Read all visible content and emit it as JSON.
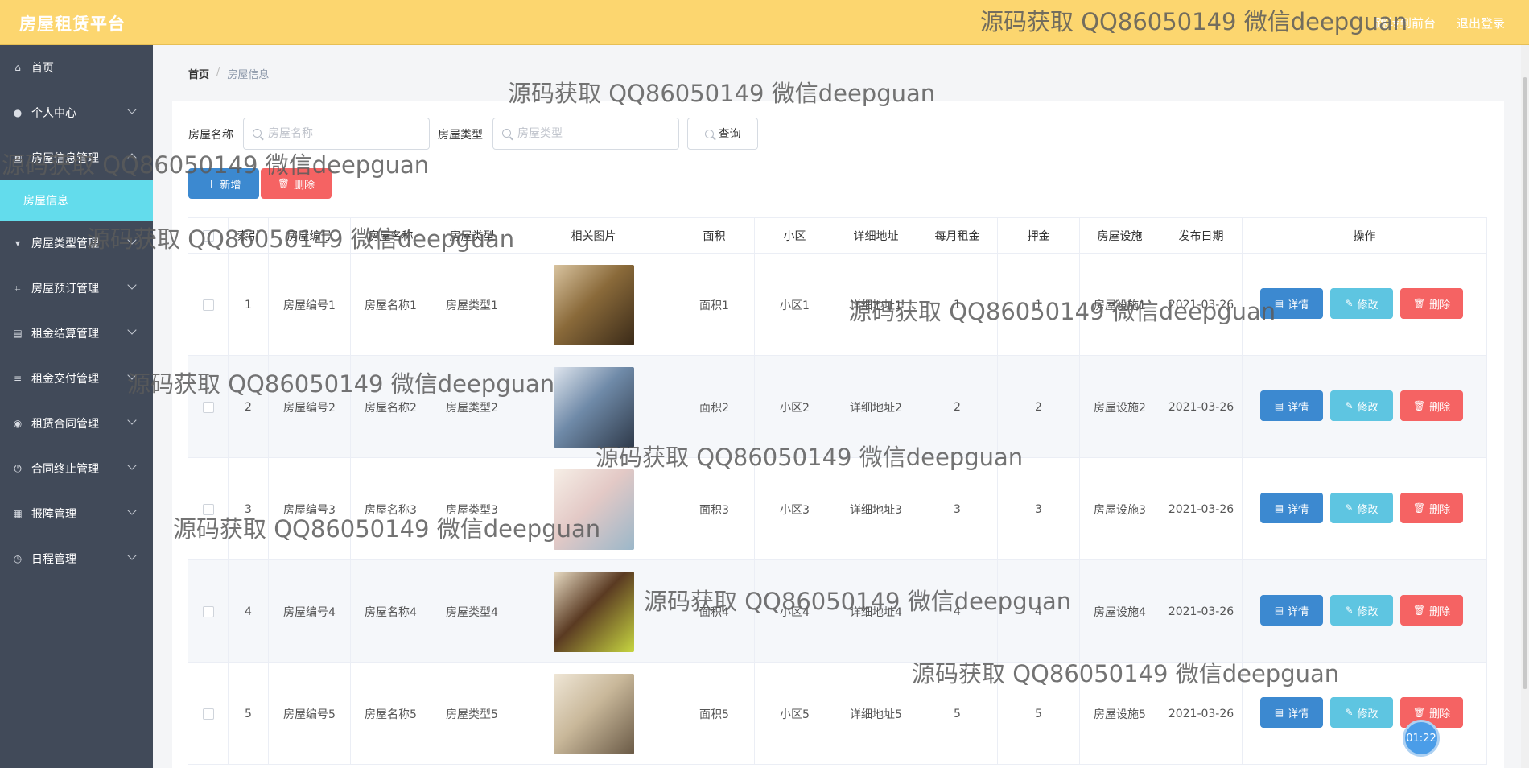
{
  "header": {
    "title": "房屋租赁平台",
    "links": [
      "跳转到前台",
      "退出登录"
    ]
  },
  "sidebar": {
    "items": [
      {
        "label": "首页",
        "icon": "home-icon"
      },
      {
        "label": "个人中心",
        "icon": "user-icon"
      },
      {
        "label": "房屋信息管理",
        "icon": "house-icon"
      },
      {
        "label": "房屋类型管理",
        "icon": "tag-icon"
      },
      {
        "label": "房屋预订管理",
        "icon": "crop-icon"
      },
      {
        "label": "租金结算管理",
        "icon": "clipboard-icon"
      },
      {
        "label": "租金交付管理",
        "icon": "list-icon"
      },
      {
        "label": "租赁合同管理",
        "icon": "location-icon"
      },
      {
        "label": "合同终止管理",
        "icon": "power-icon"
      },
      {
        "label": "报障管理",
        "icon": "grid-icon"
      },
      {
        "label": "日程管理",
        "icon": "clock-icon"
      }
    ],
    "active_sub": "房屋信息"
  },
  "breadcrumb": {
    "home": "首页",
    "sep": "/",
    "current": "房屋信息"
  },
  "search": {
    "name_label": "房屋名称",
    "name_placeholder": "房屋名称",
    "type_label": "房屋类型",
    "type_placeholder": "房屋类型",
    "query_label": "查询"
  },
  "actions": {
    "add_label": "新增",
    "delete_label": "删除"
  },
  "table": {
    "columns": [
      "索引",
      "房屋编号",
      "房屋名称",
      "房屋类型",
      "相关图片",
      "面积",
      "小区",
      "详细地址",
      "每月租金",
      "押金",
      "房屋设施",
      "发布日期",
      "操作"
    ],
    "op_labels": {
      "detail": "详情",
      "edit": "修改",
      "delete": "删除"
    },
    "rows": [
      {
        "index": "1",
        "code": "房屋编号1",
        "name": "房屋名称1",
        "type": "房屋类型1",
        "area": "面积1",
        "community": "小区1",
        "address": "详细地址1",
        "rent": "1",
        "deposit": "1",
        "facilities": "房屋设施1",
        "date": "2021-03-26",
        "img_colors": [
          "#8a6a3a",
          "#3a2a18",
          "#d9c4a0"
        ]
      },
      {
        "index": "2",
        "code": "房屋编号2",
        "name": "房屋名称2",
        "type": "房屋类型2",
        "area": "面积2",
        "community": "小区2",
        "address": "详细地址2",
        "rent": "2",
        "deposit": "2",
        "facilities": "房屋设施2",
        "date": "2021-03-26",
        "img_colors": [
          "#6f8aa8",
          "#2f3a4a",
          "#dfe5ee"
        ]
      },
      {
        "index": "3",
        "code": "房屋编号3",
        "name": "房屋名称3",
        "type": "房屋类型3",
        "area": "面积3",
        "community": "小区3",
        "address": "详细地址3",
        "rent": "3",
        "deposit": "3",
        "facilities": "房屋设施3",
        "date": "2021-03-26",
        "img_colors": [
          "#e3c9c6",
          "#9bb7c9",
          "#f6eee6"
        ]
      },
      {
        "index": "4",
        "code": "房屋编号4",
        "name": "房屋名称4",
        "type": "房屋类型4",
        "area": "面积4",
        "community": "小区4",
        "address": "详细地址4",
        "rent": "4",
        "deposit": "4",
        "facilities": "房屋设施4",
        "date": "2021-03-26",
        "img_colors": [
          "#5a3a22",
          "#c7d640",
          "#e8dcc4"
        ]
      },
      {
        "index": "5",
        "code": "房屋编号5",
        "name": "房屋名称5",
        "type": "房屋类型5",
        "area": "面积5",
        "community": "小区5",
        "address": "详细地址5",
        "rent": "5",
        "deposit": "5",
        "facilities": "房屋设施5",
        "date": "2021-03-26",
        "img_colors": [
          "#c9b89a",
          "#6a5a46",
          "#efe6d6"
        ]
      }
    ]
  },
  "watermark": "源码获取 QQ86050149 微信deepguan",
  "timer": "01:22"
}
